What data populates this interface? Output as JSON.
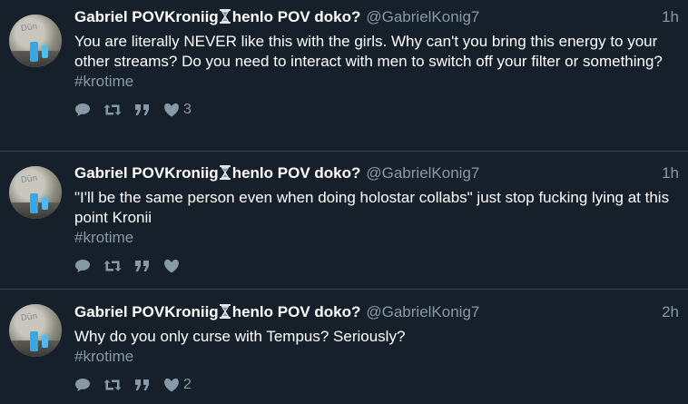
{
  "tweets": [
    {
      "name": "Gabriel POVKroniig",
      "name_suffix": " henlo POV doko?",
      "handle": "@GabrielKonig7",
      "time": "1h",
      "text": "You are literally NEVER like this with the girls. Why can't you bring this energy to your other streams? Do you need to interact with men to switch off your filter or something?",
      "hashtag": "#krotime",
      "likes": "3"
    },
    {
      "name": "Gabriel POVKroniig",
      "name_suffix": " henlo POV doko?",
      "handle": "@GabrielKonig7",
      "time": "1h",
      "text": "\"I'll be the same person even when doing holostar collabs\" just stop fucking lying at this point Kronii",
      "hashtag": "#krotime",
      "likes": ""
    },
    {
      "name": "Gabriel POVKroniig",
      "name_suffix": " henlo POV doko?",
      "handle": "@GabrielKonig7",
      "time": "2h",
      "text": "Why do you only curse with Tempus? Seriously?",
      "hashtag": "#krotime",
      "likes": "2"
    }
  ],
  "icons": {
    "reply": "reply-icon",
    "retweet": "retweet-icon",
    "quote": "quote-icon",
    "like": "heart-icon",
    "emoji": "hourglass-icon"
  },
  "colors": {
    "background": "#15202b",
    "muted": "#8899a6",
    "divider": "#38444d"
  }
}
